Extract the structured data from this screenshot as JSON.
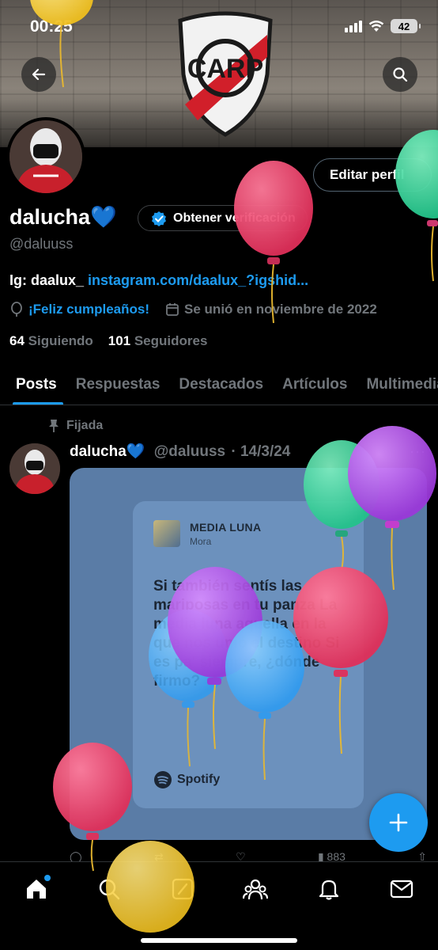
{
  "status_bar": {
    "time": "00:25",
    "battery": "42"
  },
  "profile": {
    "edit_label": "Editar perfil",
    "name": "dalucha💙",
    "verify_label": "Obtener verificación",
    "handle": "@daluuss",
    "bio_prefix": "Ig: daalux_",
    "bio_link": "instagram.com/daalux_?igshid...",
    "birthday": "¡Feliz cumpleaños!",
    "joined": "Se unió en noviembre de 2022",
    "following_count": "64",
    "following_label": "Siguiendo",
    "followers_count": "101",
    "followers_label": "Seguidores"
  },
  "tabs": [
    "Posts",
    "Respuestas",
    "Destacados",
    "Artículos",
    "Multimedia"
  ],
  "post": {
    "pinned_label": "Fijada",
    "author_name": "dalucha💙",
    "author_handle": "@daluuss",
    "date": "· 14/3/24",
    "song_title": "MEDIA LUNA",
    "song_artist": "Mora",
    "lyrics": "Si también sentís las mariposas en tu panza La media luna aquella en la que nos unió el destino Si es pa' siempre, ¿dónde firmo?",
    "spotify_label": "Spotify",
    "views": "883"
  },
  "colors": {
    "accent": "#1d9bf0",
    "background": "#000000",
    "muted": "#71767b",
    "border": "#2f3336"
  },
  "icons": {
    "back": "back-arrow-icon",
    "search": "search-icon",
    "verified": "verified-badge-icon",
    "balloon": "location-icon",
    "calendar": "calendar-icon",
    "pin": "pin-icon",
    "compose": "plus-icon",
    "home": "home-icon",
    "explore": "search-icon",
    "grok": "grok-icon",
    "communities": "communities-icon",
    "notifications": "bell-icon",
    "messages": "mail-icon"
  }
}
